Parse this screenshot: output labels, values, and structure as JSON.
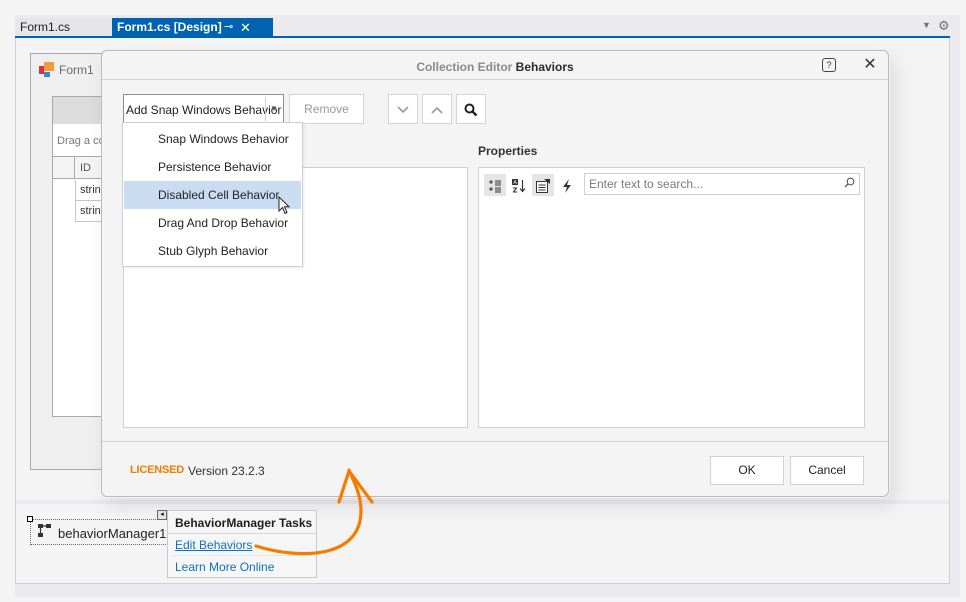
{
  "ide": {
    "tabs": [
      {
        "label": "Form1.cs",
        "active": false
      },
      {
        "label": "Form1.cs [Design]",
        "active": true,
        "pin_icon": "⊸",
        "close_icon": "✕"
      }
    ],
    "tab_menu_icon": "▼",
    "settings_icon": "⚙"
  },
  "form": {
    "title": "Form1",
    "grid_hint": "Drag a column header here to group by that column",
    "columns": [
      "ID"
    ],
    "rows": [
      "string",
      "string"
    ]
  },
  "dialog": {
    "title_prefix": "Collection Editor",
    "title_main": "Behaviors",
    "help_icon": "?",
    "close_icon": "✕",
    "add_combo": {
      "value": "Add Snap Windows Behavior",
      "arrow": "▼"
    },
    "remove_label": "Remove",
    "move_down_icon": "⌄",
    "move_up_icon": "⌃",
    "search_icon": "🔍",
    "dropdown_items": [
      {
        "label": "Snap Windows Behavior",
        "hover": false
      },
      {
        "label": "Persistence Behavior",
        "hover": false
      },
      {
        "label": "Disabled Cell Behavior",
        "hover": true
      },
      {
        "label": "Drag And Drop Behavior",
        "hover": false
      },
      {
        "label": "Stub Glyph Behavior",
        "hover": false
      }
    ],
    "properties": {
      "label": "Properties",
      "search_placeholder": "Enter text to search...",
      "search_icon": "⌕",
      "toolbar": {
        "categorized_icon": "⁺≡",
        "alphabetical_icon": "A↓",
        "properties_icon": "▤",
        "events_icon": "ϟ"
      }
    },
    "footer": {
      "license": "LICENSED",
      "version": "Version 23.2.3",
      "ok_label": "OK",
      "cancel_label": "Cancel"
    }
  },
  "tray": {
    "component_label": "behaviorManager1",
    "smart_tag_glyph": "◂",
    "tasks": {
      "title": "BehaviorManager Tasks",
      "edit_link": "Edit Behaviors",
      "learn_link": "Learn More Online"
    }
  },
  "colors": {
    "accent": "#0063b1",
    "license": "#f07d00",
    "annotation_arrow": "#f57c00",
    "hover_item": "#c9dcf2",
    "link": "#0e70c0"
  }
}
